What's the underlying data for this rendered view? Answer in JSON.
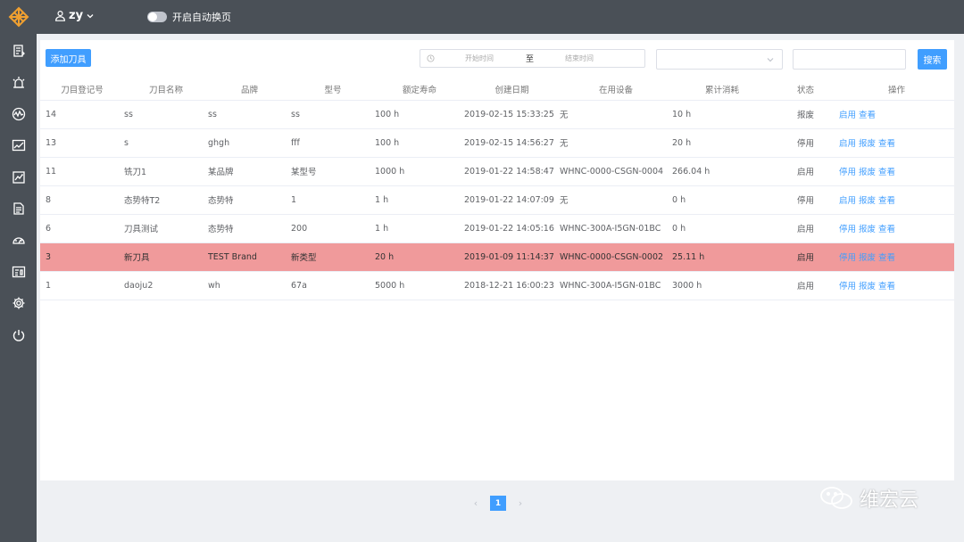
{
  "header": {
    "username": "zy",
    "auto_page_label": "开启自动换页"
  },
  "toolbar": {
    "add_label": "添加刀具",
    "start_placeholder": "开始时间",
    "range_separator": "至",
    "end_placeholder": "结束时间",
    "search_label": "搜索"
  },
  "table": {
    "columns": [
      "刀目登记号",
      "刀目名称",
      "品牌",
      "型号",
      "额定寿命",
      "创建日期",
      "在用设备",
      "累计消耗",
      "状态",
      "操作"
    ],
    "rows": [
      {
        "id": "14",
        "name": "ss",
        "brand": "ss",
        "model": "ss",
        "life": "100 h",
        "date": "2019-02-15 15:33:25",
        "device": "无",
        "usage": "10 h",
        "status": "报废",
        "actions": [
          "启用",
          "查看"
        ]
      },
      {
        "id": "13",
        "name": "s",
        "brand": "ghgh",
        "model": "fff",
        "life": "100 h",
        "date": "2019-02-15 14:56:27",
        "device": "无",
        "usage": "20 h",
        "status": "停用",
        "actions": [
          "启用",
          "报废",
          "查看"
        ]
      },
      {
        "id": "11",
        "name": "铣刀1",
        "brand": "某品牌",
        "model": "某型号",
        "life": "1000 h",
        "date": "2019-01-22 14:58:47",
        "device": "WHNC-0000-CSGN-0004",
        "usage": "266.04 h",
        "status": "启用",
        "actions": [
          "停用",
          "报废",
          "查看"
        ]
      },
      {
        "id": "8",
        "name": "态势特T2",
        "brand": "态势特",
        "model": "1",
        "life": "1 h",
        "date": "2019-01-22 14:07:09",
        "device": "无",
        "usage": "0 h",
        "status": "停用",
        "actions": [
          "启用",
          "报废",
          "查看"
        ]
      },
      {
        "id": "6",
        "name": "刀具测试",
        "brand": "态势特",
        "model": "200",
        "life": "1 h",
        "date": "2019-01-22 14:05:16",
        "device": "WHNC-300A-I5GN-01BC",
        "usage": "0 h",
        "status": "启用",
        "actions": [
          "停用",
          "报废",
          "查看"
        ]
      },
      {
        "id": "3",
        "name": "新刀具",
        "brand": "TEST Brand",
        "model": "新类型",
        "life": "20 h",
        "date": "2019-01-09 11:14:37",
        "device": "WHNC-0000-CSGN-0002",
        "usage": "25.11 h",
        "status": "启用",
        "actions": [
          "停用",
          "报废",
          "查看"
        ]
      },
      {
        "id": "1",
        "name": "daoju2",
        "brand": "wh",
        "model": "67a",
        "life": "5000 h",
        "date": "2018-12-21 16:00:23",
        "device": "WHNC-300A-I5GN-01BC",
        "usage": "3000 h",
        "status": "启用",
        "actions": [
          "停用",
          "报废",
          "查看"
        ]
      }
    ]
  },
  "pagination": {
    "current": "1",
    "prev_icon": "chevron-left-icon",
    "next_icon": "chevron-right-icon"
  },
  "watermark": {
    "text": "维宏云"
  },
  "colors": {
    "sidebar": "#4a5057",
    "accent": "#409eff",
    "highlight_row": "#f09a9b",
    "logo": "#f0a030"
  },
  "sidebar_icons": [
    "report-icon",
    "alarm-icon",
    "monitor-icon",
    "trend-chart-icon",
    "analysis-icon",
    "document-icon",
    "dashboard-icon",
    "data-card-icon",
    "settings-icon",
    "power-icon"
  ]
}
